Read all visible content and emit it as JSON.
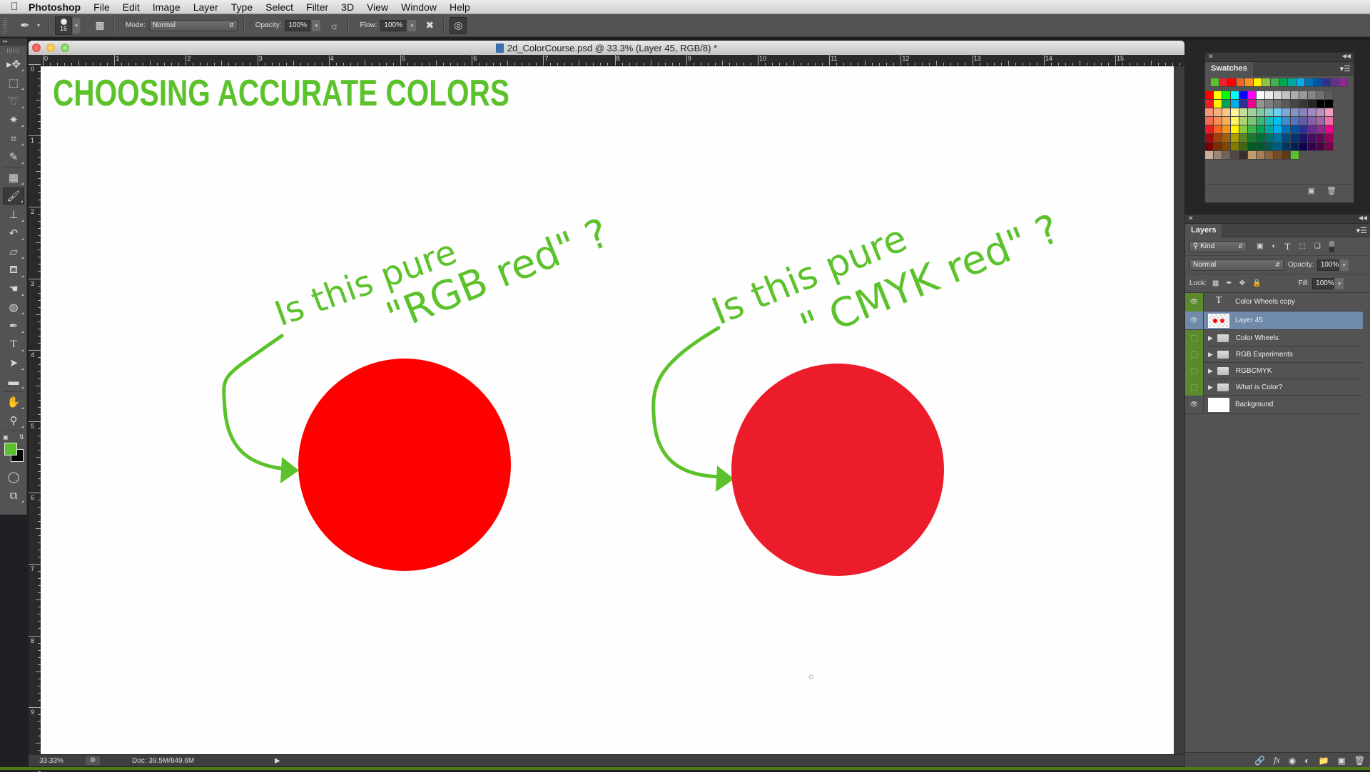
{
  "menubar": {
    "apple": "",
    "app": "Photoshop",
    "items": [
      "File",
      "Edit",
      "Image",
      "Layer",
      "Type",
      "Select",
      "Filter",
      "3D",
      "View",
      "Window",
      "Help"
    ]
  },
  "options_bar": {
    "tool_icon": "brush-icon",
    "brush_size": "16",
    "mode_label": "Mode:",
    "mode_value": "Normal",
    "opacity_label": "Opacity:",
    "opacity_value": "100%",
    "flow_label": "Flow:",
    "flow_value": "100%"
  },
  "tools": [
    {
      "name": "move-tool",
      "glyph": "▸✥"
    },
    {
      "name": "marquee-tool",
      "glyph": "⬚"
    },
    {
      "name": "lasso-tool",
      "glyph": "➰"
    },
    {
      "name": "magic-wand-tool",
      "glyph": "✷"
    },
    {
      "name": "crop-tool",
      "glyph": "⌗"
    },
    {
      "name": "eyedropper-tool",
      "glyph": "✎"
    },
    {
      "name": "healing-brush-tool",
      "glyph": "▦"
    },
    {
      "name": "brush-tool",
      "glyph": "🖌"
    },
    {
      "name": "clone-stamp-tool",
      "glyph": "⊥"
    },
    {
      "name": "history-brush-tool",
      "glyph": "↶"
    },
    {
      "name": "eraser-tool",
      "glyph": "▱"
    },
    {
      "name": "paint-bucket-tool",
      "glyph": "⛾"
    },
    {
      "name": "smudge-tool",
      "glyph": "☚"
    },
    {
      "name": "sponge-tool",
      "glyph": "◍"
    },
    {
      "name": "pen-tool",
      "glyph": "✒"
    },
    {
      "name": "type-tool",
      "glyph": "T"
    },
    {
      "name": "path-selection-tool",
      "glyph": "➤"
    },
    {
      "name": "rectangle-tool",
      "glyph": "▬"
    },
    {
      "name": "hand-tool",
      "glyph": "✋"
    },
    {
      "name": "zoom-tool",
      "glyph": "⚲"
    }
  ],
  "colors": {
    "foreground": "#5cc22b",
    "background": "#000000",
    "accent_green": "#5cc22b",
    "rgb_red": "#ff0000",
    "cmyk_red": "#ed1c2b",
    "layer_selected": "#6f8aab"
  },
  "document": {
    "title": "2d_ColorCourse.psd @ 33.3% (Layer 45, RGB/8) *",
    "h_ruler_labels": [
      "0",
      "1",
      "2",
      "3",
      "4",
      "5",
      "6",
      "7",
      "8",
      "9",
      "10",
      "11",
      "12",
      "13",
      "14",
      "15"
    ],
    "v_ruler_labels": [
      "0",
      "1",
      "2",
      "3",
      "4",
      "5",
      "6",
      "7",
      "8",
      "9"
    ],
    "canvas": {
      "heading": "CHOOSING ACCURATE COLORS",
      "annotation_left": {
        "line1": "Is this pure",
        "line2": "\"RGB  red\" ?"
      },
      "annotation_right": {
        "line1": "Is this pure",
        "line2": "\" CMYK red\" ?"
      }
    },
    "status": {
      "zoom": "33.33%",
      "doc_size": "Doc: 39.5M/849.6M"
    }
  },
  "swatches_panel": {
    "title": "Swatches",
    "recent": [
      "#5cc22b",
      "#e8232f",
      "#ff0000",
      "#f26522",
      "#f7941d",
      "#fff200",
      "#8dc63f",
      "#39b54a",
      "#00a651",
      "#00a99d",
      "#00aeef",
      "#0072bc",
      "#0054a6",
      "#2e3192",
      "#662d91",
      "#92278f"
    ],
    "grid": [
      [
        "#ff0000",
        "#ffff00",
        "#00ff00",
        "#00ffff",
        "#0000ff",
        "#ff00ff",
        "#ffffff",
        "#ebebeb",
        "#d7d7d7",
        "#c2c2c2",
        "#adadad",
        "#999999",
        "#858585",
        "#707070",
        "#5c5c5c"
      ],
      [
        "#ed1c24",
        "#fff200",
        "#00a651",
        "#00aeef",
        "#2e3192",
        "#ec008c",
        "#959595",
        "#808080",
        "#6d6d6d",
        "#595959",
        "#464646",
        "#363636",
        "#252525",
        "#000000",
        "#000000"
      ],
      [
        "#f7977a",
        "#f9ad81",
        "#fdc68a",
        "#fff79a",
        "#c4df9b",
        "#a3d39c",
        "#82ca9d",
        "#7bcdc8",
        "#6ecff6",
        "#7ea7d8",
        "#8493ca",
        "#8882be",
        "#a187be",
        "#bc8dbf",
        "#f49ac2"
      ],
      [
        "#f26c4f",
        "#f68e55",
        "#fbaf5c",
        "#fff467",
        "#acd372",
        "#7cc576",
        "#3bb878",
        "#1abbb4",
        "#00bff3",
        "#438ccb",
        "#5574b9",
        "#605ca8",
        "#855fa8",
        "#a763a8",
        "#f06ea9"
      ],
      [
        "#ed1c24",
        "#f26522",
        "#f7941d",
        "#fff200",
        "#8dc63f",
        "#39b54a",
        "#00a651",
        "#00a99d",
        "#00aeef",
        "#0072bc",
        "#0054a6",
        "#2e3192",
        "#662d91",
        "#92278f",
        "#ec008c"
      ],
      [
        "#9e0b0f",
        "#a0410d",
        "#a3620a",
        "#aba000",
        "#598527",
        "#1a7b30",
        "#007236",
        "#00746b",
        "#0076a3",
        "#004b80",
        "#003471",
        "#1b1464",
        "#440e62",
        "#630460",
        "#9e005d"
      ],
      [
        "#790000",
        "#7b2e00",
        "#7d4900",
        "#827b00",
        "#406618",
        "#005e20",
        "#005826",
        "#005952",
        "#005b7f",
        "#003663",
        "#002157",
        "#0d004c",
        "#32004b",
        "#4b0049",
        "#7b0046"
      ],
      [
        "#c7b299",
        "#998675",
        "#736357",
        "#534741",
        "#37302d",
        "#c69c6d",
        "#a67c52",
        "#8c6239",
        "#754c24",
        "#603913",
        "#5cc22b"
      ]
    ]
  },
  "layers_panel": {
    "title": "Layers",
    "filter_kind": "Kind",
    "blend_mode": "Normal",
    "opacity_label": "Opacity:",
    "opacity_value": "100%",
    "lock_label": "Lock:",
    "fill_label": "Fill:",
    "fill_value": "100%",
    "layers": [
      {
        "name": "Color Wheels copy",
        "type": "text",
        "visible": true,
        "green_vis": true,
        "selected": false
      },
      {
        "name": "Layer 45",
        "type": "pixel",
        "visible": true,
        "green_vis": false,
        "selected": true
      },
      {
        "name": "Color Wheels",
        "type": "group",
        "visible": false,
        "green_vis": true,
        "selected": false
      },
      {
        "name": "RGB Experiments",
        "type": "group",
        "visible": false,
        "green_vis": true,
        "selected": false
      },
      {
        "name": "RGBCMYK",
        "type": "group",
        "visible": false,
        "green_vis": true,
        "selected": false
      },
      {
        "name": "What is Color?",
        "type": "group",
        "visible": false,
        "green_vis": true,
        "selected": false
      },
      {
        "name": "Background",
        "type": "background",
        "visible": true,
        "green_vis": false,
        "selected": false
      }
    ]
  }
}
